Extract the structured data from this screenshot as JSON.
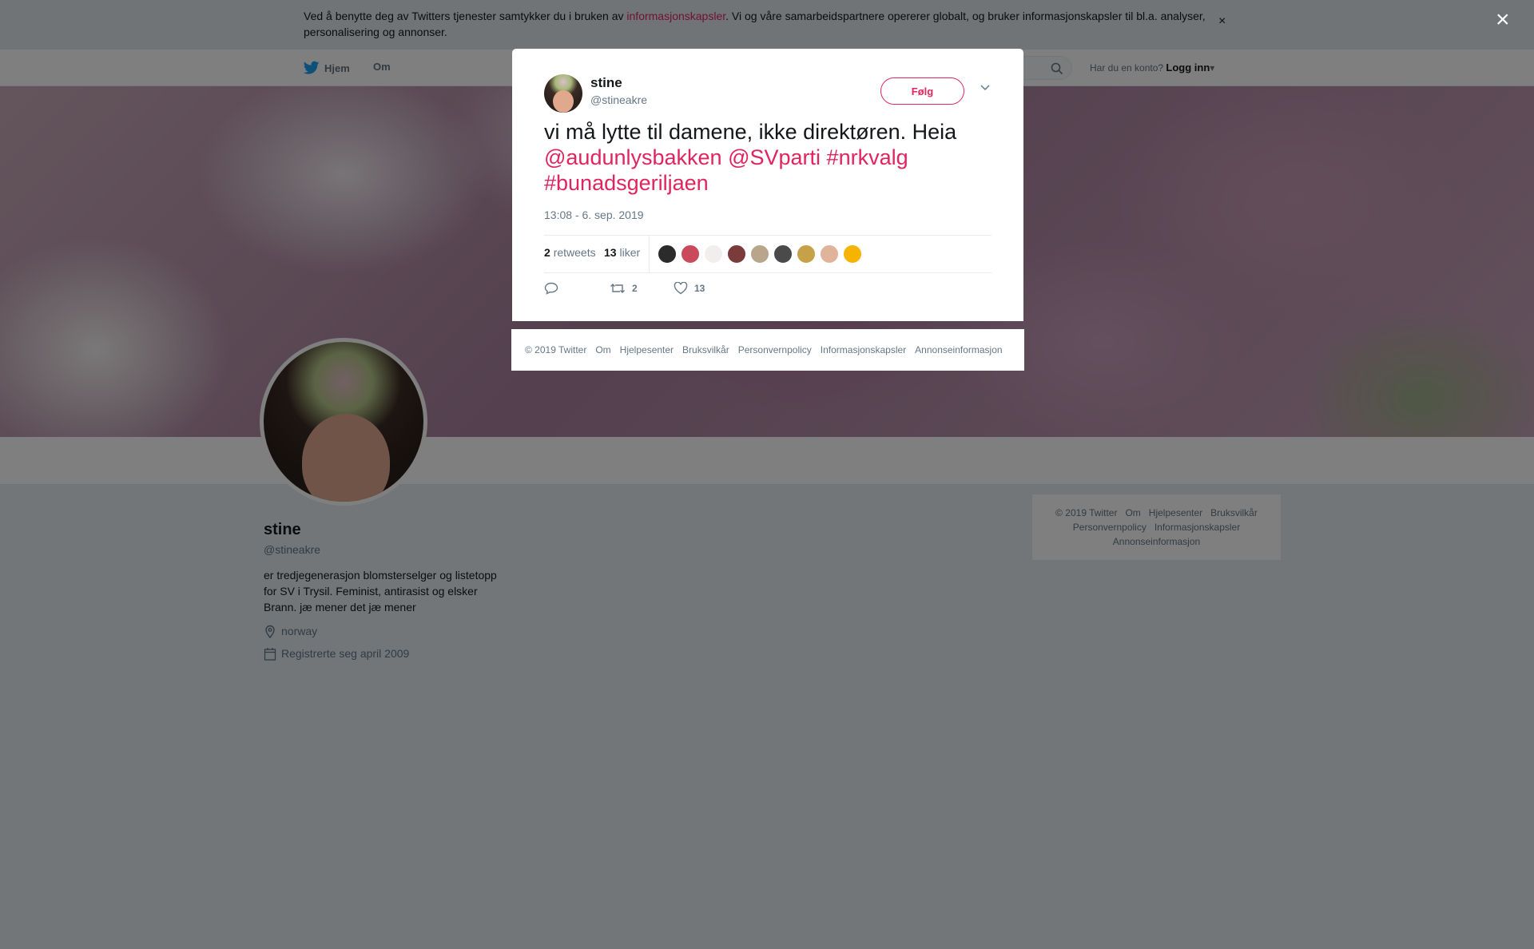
{
  "cookie": {
    "text_before": "Ved å benytte deg av Twitters tjenester samtykker du i bruken av ",
    "link": "informasjonskapsler",
    "text_after": ". Vi og våre samarbeidspartnere opererer globalt, og bruker informasjonskapsler til bl.a. analyser, personalisering og annonser.",
    "close": "×"
  },
  "nav": {
    "home": "Hjem",
    "about": "Om",
    "account_prompt": "Har du en konto?",
    "login": "Logg inn"
  },
  "profile": {
    "name": "stine",
    "handle": "@stineakre",
    "bio": "er tredjegenerasjon blomsterselger og listetopp for SV i Trysil. Feminist, antirasist og elsker Brann. jæ mener det jæ mener",
    "location": "norway",
    "joined": "Registrerte seg april 2009"
  },
  "side_footer": {
    "copyright": "© 2019 Twitter",
    "about": "Om",
    "help": "Hjelpesenter",
    "terms": "Bruksvilkår",
    "privacy": "Personvernpolicy",
    "cookies": "Informasjonskapsler",
    "ads": "Annonseinformasjon"
  },
  "overlay": {
    "close": "×"
  },
  "tweet": {
    "name": "stine",
    "handle": "@stineakre",
    "follow": "Følg",
    "text_plain": "vi må lytte til damene, ikke direktøren. Heia ",
    "mention1": "@audunlysbakken",
    "mention2": "@SVparti",
    "hashtag1": "#nrkvalg",
    "hashtag2": "#bunadsgeriljaen",
    "time": "13:08 - 6. sep. 2019",
    "retweets_count": "2",
    "retweets_label": "retweets",
    "likes_count": "13",
    "likes_label": "liker",
    "action_retweets": "2",
    "action_likes": "13",
    "liker_colors": [
      "#2b2b2b",
      "#c94a5a",
      "#f3eeee",
      "#7a3b3b",
      "#b8a58c",
      "#4a4a4a",
      "#c7a04a",
      "#e0b49a",
      "#f5b400"
    ]
  },
  "modal_footer": {
    "copyright": "© 2019 Twitter",
    "about": "Om",
    "help": "Hjelpesenter",
    "terms": "Bruksvilkår",
    "privacy": "Personvernpolicy",
    "cookies": "Informasjonskapsler",
    "ads": "Annonseinformasjon"
  },
  "colors": {
    "accent": "#e0245e",
    "twitter_blue": "#1da1f2",
    "muted": "#657786"
  }
}
